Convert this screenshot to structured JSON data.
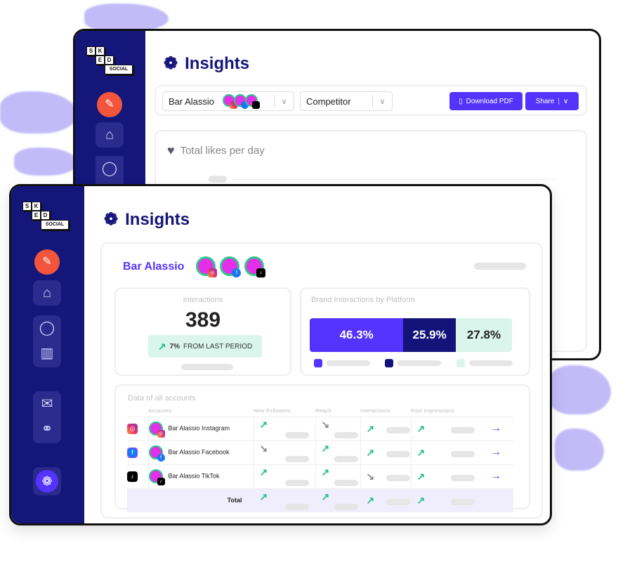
{
  "brand": {
    "logo_letters": [
      "S",
      "K",
      "E",
      "D",
      "SOCIAL"
    ]
  },
  "colors": {
    "navy": "#15167a",
    "accent": "#5533ff",
    "mint": "#d9f5ec",
    "up": "#22c08a",
    "red": "#f2553b"
  },
  "back": {
    "title": "Insights",
    "account_select": "Bar Alassio",
    "compare_select": "Competitor",
    "download_label": "Download PDF",
    "share_label": "Share",
    "chart_title": "Total likes per day"
  },
  "front": {
    "title": "Insights",
    "account_name": "Bar Alassio",
    "interactions": {
      "label": "Interactions",
      "value": "389",
      "change": "7%",
      "change_label": "FROM LAST PERIOD"
    },
    "platform": {
      "label": "Brand Interactions by Platform",
      "segments": [
        {
          "value": 46.3,
          "text": "46.3%",
          "color": "#5533ff"
        },
        {
          "value": 25.9,
          "text": "25.9%",
          "color": "#13137a"
        },
        {
          "value": 27.8,
          "text": "27.8%",
          "color": "#d9f5ec"
        }
      ]
    },
    "table": {
      "title": "Data of all accounts",
      "headers": [
        "Accounts",
        "New Followers",
        "Reach",
        "Interactions",
        "Post Impressions"
      ],
      "rows": [
        {
          "platform": "instagram",
          "name": "Bar Alassio Instagram",
          "trends": [
            "up",
            "down",
            "up",
            "up"
          ]
        },
        {
          "platform": "facebook",
          "name": "Bar Alassio Facebook",
          "trends": [
            "down",
            "up",
            "up",
            "up"
          ]
        },
        {
          "platform": "tiktok",
          "name": "Bar Alassio TikTok",
          "trends": [
            "up",
            "up",
            "down",
            "up"
          ]
        }
      ],
      "total_label": "Total",
      "total_trends": [
        "up",
        "up",
        "up",
        "up"
      ]
    }
  }
}
